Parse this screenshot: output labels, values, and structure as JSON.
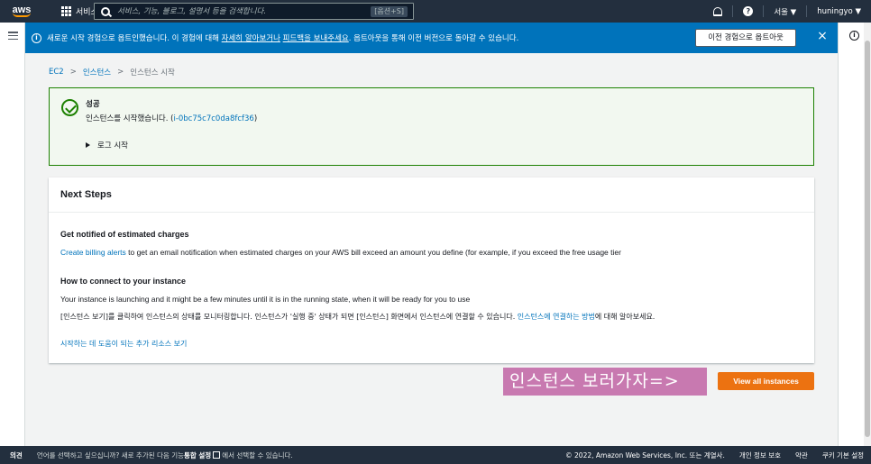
{
  "nav": {
    "logo": "aws",
    "services_label": "서비스",
    "search_placeholder": "서비스, 기능, 블로그, 설명서 등을 검색합니다.",
    "search_shortcut": "[옵션+S]",
    "region": "서울 ▼",
    "user": "huningyo ▼"
  },
  "banner": {
    "text_before": "새로운 시작 경험으로 옵트인했습니다. 이 경험에 대해 ",
    "link1": "자세히 알아보거나",
    "link2": "피드백을 보내주세요",
    "text_after": ". 옵트아웃을 통해 이전 버전으로 돌아갈 수 있습니다.",
    "opt_out_button": "이전 경험으로 옵트아웃",
    "close": "×"
  },
  "breadcrumb": {
    "items": [
      "EC2",
      "인스턴스"
    ],
    "current": "인스턴스 시작",
    "separator": ">"
  },
  "success": {
    "title": "성공",
    "message_prefix": "인스턴스를 시작했습니다. (",
    "instance_id": "i-0bc75c7c0da8fcf36",
    "message_suffix": ")",
    "log_toggle": "로그 시작"
  },
  "next_steps": {
    "title": "Next Steps",
    "billing_heading": "Get notified of estimated charges",
    "billing_link": "Create billing alerts",
    "billing_text": " to get an email notification when estimated charges on your AWS bill exceed an amount you define (for example, if you exceed the free usage tier",
    "connect_heading": "How to connect to your instance",
    "connect_text": "Your instance is launching and it might be a few minutes until it is in the running state, when it will be ready for you to use",
    "connect_ko_prefix": "[인스턴스 보기]를 클릭하여 인스턴스의 상태를 모니터링합니다. 인스턴스가 '실행 중' 상태가 되면 [인스턴스] 화면에서 인스턴스에 연결할 수 있습니다. ",
    "connect_ko_link": "인스턴스에 연결하는 방법",
    "connect_ko_suffix": "에 대해 알아보세요.",
    "resources_link": "시작하는 데 도움이 되는 추가 리소스 보기"
  },
  "overlay_text": "인스턴스 보러가자=>",
  "view_all_button": "View all instances",
  "footer": {
    "feedback": "의견",
    "lang_prefix": "언어를 선택하고 싶으십니까? 새로 추가된 다음 기능",
    "lang_bold": "통합 설정",
    "lang_suffix": "에서 선택할 수 있습니다.",
    "copyright": "© 2022, Amazon Web Services, Inc. 또는 계열사.",
    "privacy": "개인 정보 보호",
    "terms": "약관",
    "cookies": "쿠키 기본 설정"
  },
  "colors": {
    "nav_bg": "#232f3e",
    "banner_bg": "#0073bb",
    "success_border": "#1d8102",
    "primary_button": "#ec7211",
    "link": "#0073bb",
    "overlay_bg": "#c879b0"
  }
}
